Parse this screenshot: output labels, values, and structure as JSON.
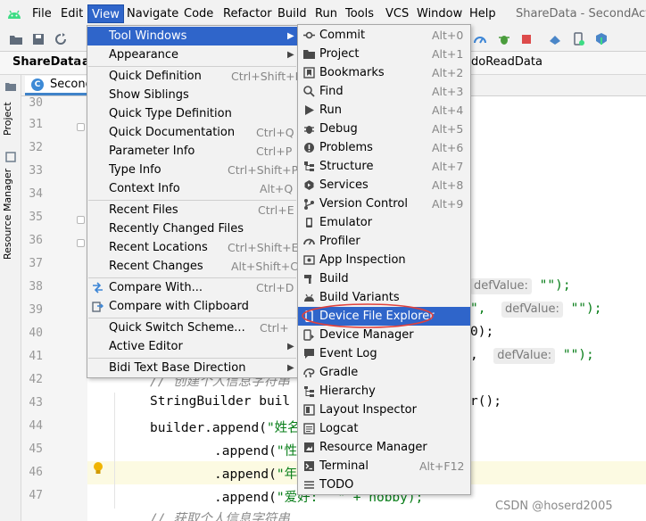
{
  "menubar": {
    "items": [
      {
        "label": "File"
      },
      {
        "label": "Edit"
      },
      {
        "label": "View"
      },
      {
        "label": "Navigate"
      },
      {
        "label": "Code"
      },
      {
        "label": "Refactor"
      },
      {
        "label": "Build"
      },
      {
        "label": "Run"
      },
      {
        "label": "Tools"
      },
      {
        "label": "VCS"
      },
      {
        "label": "Window"
      },
      {
        "label": "Help"
      }
    ],
    "title": "ShareData - SecondActiv"
  },
  "breadcrumb": {
    "project": "ShareData",
    "next": "a",
    "right": "doReadData"
  },
  "stripe": {
    "project": "Project",
    "resource_manager": "Resource Manager"
  },
  "editor": {
    "tab_label": "SecondA",
    "line_numbers": [
      "30",
      "31",
      "32",
      "33",
      "34",
      "35",
      "36",
      "37",
      "38",
      "39",
      "40",
      "41",
      "42",
      "43",
      "44",
      "45",
      "46",
      "47"
    ],
    "lines": {
      "l38_hint": "defValue:",
      "l38_tail": "\"\");",
      "l39_head": "\",",
      "l39_hint": "defValue:",
      "l39_tail": "\"\");",
      "l40_tail": "0);",
      "l41_head": ",",
      "l41_hint": "defValue:",
      "l41_tail": "\"\");",
      "l42_comment": "// 创建个人信息字符串",
      "l43_a": "StringBuilder buil",
      "l43_b": "r();",
      "l44_a": "builder.append(",
      "l44_str": "\"姓名",
      "l45_a": ".append(",
      "l45_str": "\"性",
      "l46_a": ".append(",
      "l46_str": "\"年",
      "l47_a": ".append(",
      "l47_str": "\"爱好:",
      "l47_tail": "\" + hobby);",
      "l48_comment": "// 获取个人信息字符串"
    }
  },
  "view_menu": {
    "items": [
      {
        "label": "Tool Windows",
        "shortcut": "",
        "submenu": true
      },
      {
        "label": "Appearance",
        "shortcut": "",
        "submenu": true
      },
      {
        "label": "Quick Definition",
        "shortcut": "Ctrl+Shift+I"
      },
      {
        "label": "Show Siblings",
        "shortcut": ""
      },
      {
        "label": "Quick Type Definition",
        "shortcut": ""
      },
      {
        "label": "Quick Documentation",
        "shortcut": "Ctrl+Q"
      },
      {
        "label": "Parameter Info",
        "shortcut": "Ctrl+P"
      },
      {
        "label": "Type Info",
        "shortcut": "Ctrl+Shift+P"
      },
      {
        "label": "Context Info",
        "shortcut": "Alt+Q"
      },
      {
        "label": "Recent Files",
        "shortcut": "Ctrl+E"
      },
      {
        "label": "Recently Changed Files",
        "shortcut": ""
      },
      {
        "label": "Recent Locations",
        "shortcut": "Ctrl+Shift+E"
      },
      {
        "label": "Recent Changes",
        "shortcut": "Alt+Shift+C"
      },
      {
        "label": "Compare With...",
        "shortcut": "Ctrl+D"
      },
      {
        "label": "Compare with Clipboard",
        "shortcut": ""
      },
      {
        "label": "Quick Switch Scheme...",
        "shortcut": "Ctrl+"
      },
      {
        "label": "Active Editor",
        "shortcut": "",
        "submenu": true
      },
      {
        "label": "Bidi Text Base Direction",
        "shortcut": "",
        "submenu": true
      }
    ]
  },
  "tool_windows_menu": {
    "items": [
      {
        "label": "Commit",
        "shortcut": "Alt+0",
        "icon": "commit-icon"
      },
      {
        "label": "Project",
        "shortcut": "Alt+1",
        "icon": "folder-icon"
      },
      {
        "label": "Bookmarks",
        "shortcut": "Alt+2",
        "icon": "bookmark-icon"
      },
      {
        "label": "Find",
        "shortcut": "Alt+3",
        "icon": "search-icon"
      },
      {
        "label": "Run",
        "shortcut": "Alt+4",
        "icon": "run-icon"
      },
      {
        "label": "Debug",
        "shortcut": "Alt+5",
        "icon": "bug-icon"
      },
      {
        "label": "Problems",
        "shortcut": "Alt+6",
        "icon": "problems-icon"
      },
      {
        "label": "Structure",
        "shortcut": "Alt+7",
        "icon": "structure-icon"
      },
      {
        "label": "Services",
        "shortcut": "Alt+8",
        "icon": "services-icon"
      },
      {
        "label": "Version Control",
        "shortcut": "Alt+9",
        "icon": "vcs-icon"
      },
      {
        "label": "Emulator",
        "shortcut": "",
        "icon": "emulator-icon"
      },
      {
        "label": "Profiler",
        "shortcut": "",
        "icon": "profiler-icon"
      },
      {
        "label": "App Inspection",
        "shortcut": "",
        "icon": "inspection-icon"
      },
      {
        "label": "Build",
        "shortcut": "",
        "icon": "hammer-icon"
      },
      {
        "label": "Build Variants",
        "shortcut": "",
        "icon": "android-icon"
      },
      {
        "label": "Device File Explorer",
        "shortcut": "",
        "icon": "device-icon"
      },
      {
        "label": "Device Manager",
        "shortcut": "",
        "icon": "device-manager-icon"
      },
      {
        "label": "Event Log",
        "shortcut": "",
        "icon": "event-log-icon"
      },
      {
        "label": "Gradle",
        "shortcut": "",
        "icon": "gradle-icon"
      },
      {
        "label": "Hierarchy",
        "shortcut": "",
        "icon": "hierarchy-icon"
      },
      {
        "label": "Layout Inspector",
        "shortcut": "",
        "icon": "layout-inspector-icon"
      },
      {
        "label": "Logcat",
        "shortcut": "",
        "icon": "logcat-icon"
      },
      {
        "label": "Resource Manager",
        "shortcut": "",
        "icon": "resource-manager-icon"
      },
      {
        "label": "Terminal",
        "shortcut": "Alt+F12",
        "icon": "terminal-icon"
      },
      {
        "label": "TODO",
        "shortcut": "",
        "icon": "todo-icon"
      }
    ]
  },
  "watermark": "CSDN @hoserd2005",
  "colors": {
    "menu_highlight": "#2f65ca",
    "annotation_circle": "#e0413c",
    "string": "#067d17"
  }
}
